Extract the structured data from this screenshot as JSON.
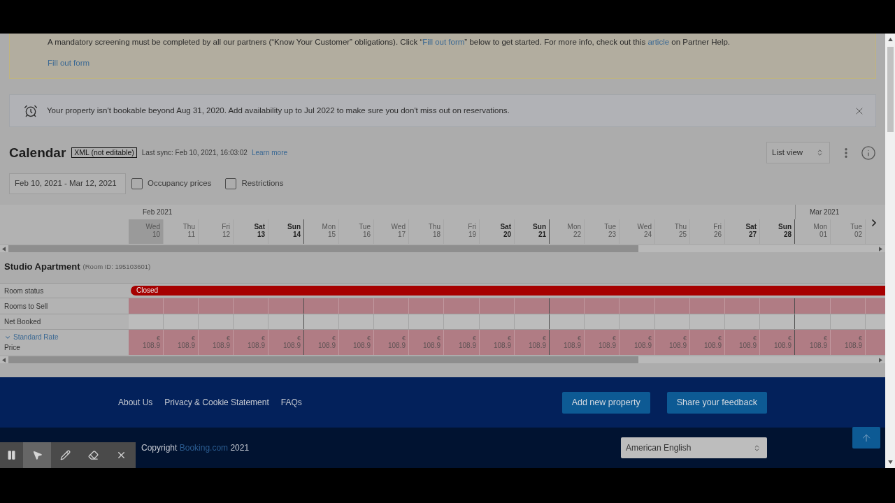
{
  "kyc_banner": {
    "message": [
      {
        "text": "A mandatory screening must be completed by all our partners (“Know Your Customer” obligations). Click “",
        "link": false
      },
      {
        "text": "Fill out form",
        "link": true
      },
      {
        "text": "” below to get started. For more info, check out this ",
        "link": false
      },
      {
        "text": "article",
        "link": true
      },
      {
        "text": " on Partner Help.",
        "link": false
      }
    ],
    "action": "Fill out form"
  },
  "availability_banner": {
    "text": "Your property isn't bookable beyond Aug 31, 2020. Add availability up to Jul 2022 to make sure you don't miss out on reservations."
  },
  "calendar": {
    "title": "Calendar",
    "badge": "XML (not editable)",
    "last_sync": "Last sync: Feb 10, 2021, 16:03:02",
    "learn_more": "Learn more",
    "view_select": "List view",
    "date_range": "Feb 10, 2021 - Mar 12, 2021",
    "filters": [
      {
        "label": "Occupancy prices",
        "checked": false
      },
      {
        "label": "Restrictions",
        "checked": false
      }
    ]
  },
  "grid": {
    "months": [
      {
        "label": "Feb 2021",
        "days": [
          {
            "weekday": "Wed",
            "day": "10",
            "kind": "weekday",
            "today": true
          },
          {
            "weekday": "Thu",
            "day": "11",
            "kind": "weekday",
            "today": false
          },
          {
            "weekday": "Fri",
            "day": "12",
            "kind": "weekday",
            "today": false
          },
          {
            "weekday": "Sat",
            "day": "13",
            "kind": "saturday",
            "today": false
          },
          {
            "weekday": "Sun",
            "day": "14",
            "kind": "sunday",
            "today": false
          },
          {
            "weekday": "Mon",
            "day": "15",
            "kind": "weekday",
            "today": false
          },
          {
            "weekday": "Tue",
            "day": "16",
            "kind": "weekday",
            "today": false
          },
          {
            "weekday": "Wed",
            "day": "17",
            "kind": "weekday",
            "today": false
          },
          {
            "weekday": "Thu",
            "day": "18",
            "kind": "weekday",
            "today": false
          },
          {
            "weekday": "Fri",
            "day": "19",
            "kind": "weekday",
            "today": false
          },
          {
            "weekday": "Sat",
            "day": "20",
            "kind": "saturday",
            "today": false
          },
          {
            "weekday": "Sun",
            "day": "21",
            "kind": "sunday",
            "today": false
          },
          {
            "weekday": "Mon",
            "day": "22",
            "kind": "weekday",
            "today": false
          },
          {
            "weekday": "Tue",
            "day": "23",
            "kind": "weekday",
            "today": false
          },
          {
            "weekday": "Wed",
            "day": "24",
            "kind": "weekday",
            "today": false
          },
          {
            "weekday": "Thu",
            "day": "25",
            "kind": "weekday",
            "today": false
          },
          {
            "weekday": "Fri",
            "day": "26",
            "kind": "weekday",
            "today": false
          },
          {
            "weekday": "Sat",
            "day": "27",
            "kind": "saturday",
            "today": false
          },
          {
            "weekday": "Sun",
            "day": "28",
            "kind": "sunday",
            "today": false
          }
        ]
      },
      {
        "label": "Mar 2021",
        "days": [
          {
            "weekday": "Mon",
            "day": "01",
            "kind": "weekday",
            "today": false
          },
          {
            "weekday": "Tue",
            "day": "02",
            "kind": "weekday",
            "today": false
          }
        ]
      }
    ]
  },
  "room": {
    "name": "Studio Apartment",
    "room_id": "(Room ID: 195103601)",
    "status": {
      "label": "Room status",
      "kind": "closed",
      "text": "Closed"
    },
    "rows": [
      {
        "label": "Rooms to Sell",
        "kind": "unavailable"
      },
      {
        "label": "Net Booked",
        "kind": "empty"
      }
    ],
    "rate": {
      "name": "Standard Rate",
      "expanded": true,
      "label": "Price",
      "prices": [
        {
          "currency": "€",
          "amount": "108.9"
        },
        {
          "currency": "€",
          "amount": "108.9"
        },
        {
          "currency": "€",
          "amount": "108.9"
        },
        {
          "currency": "€",
          "amount": "108.9"
        },
        {
          "currency": "€",
          "amount": "108.9"
        },
        {
          "currency": "€",
          "amount": "108.9"
        },
        {
          "currency": "€",
          "amount": "108.9"
        },
        {
          "currency": "€",
          "amount": "108.9"
        },
        {
          "currency": "€",
          "amount": "108.9"
        },
        {
          "currency": "€",
          "amount": "108.9"
        },
        {
          "currency": "€",
          "amount": "108.9"
        },
        {
          "currency": "€",
          "amount": "108.9"
        },
        {
          "currency": "€",
          "amount": "108.9"
        },
        {
          "currency": "€",
          "amount": "108.9"
        },
        {
          "currency": "€",
          "amount": "108.9"
        },
        {
          "currency": "€",
          "amount": "108.9"
        },
        {
          "currency": "€",
          "amount": "108.9"
        },
        {
          "currency": "€",
          "amount": "108.9"
        },
        {
          "currency": "€",
          "amount": "108.9"
        },
        {
          "currency": "€",
          "amount": "108.9"
        },
        {
          "currency": "€",
          "amount": "108.9"
        }
      ]
    }
  },
  "footer": {
    "links": [
      "About Us",
      "Privacy & Cookie Statement",
      "FAQs"
    ],
    "buttons": [
      "Add new property",
      "Share your feedback"
    ],
    "copyright": {
      "prefix": "Copyright",
      "link": "Booking.com",
      "suffix": "2021"
    },
    "language": "American English"
  },
  "recorder_toolbar": {
    "tools": [
      {
        "kind": "pause",
        "selected": false
      },
      {
        "kind": "pointer",
        "selected": true
      },
      {
        "kind": "pen",
        "selected": false
      },
      {
        "kind": "eraser",
        "selected": false
      },
      {
        "kind": "close",
        "selected": false
      }
    ]
  }
}
